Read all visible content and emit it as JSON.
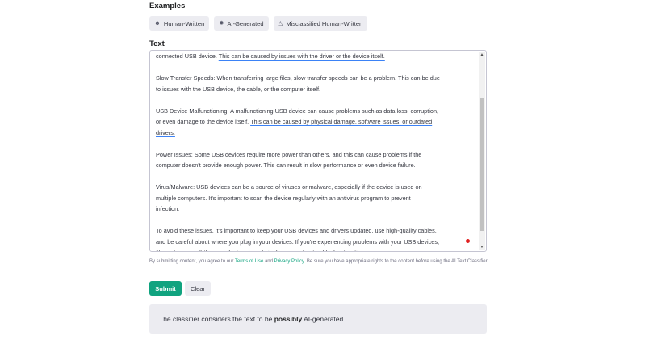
{
  "examples": {
    "title": "Examples",
    "chips": [
      {
        "icon": "user-icon",
        "label": "Human-Written"
      },
      {
        "icon": "openai-icon",
        "label": "AI-Generated"
      },
      {
        "icon": "warning-icon",
        "label": "Misclassified Human-Written"
      }
    ]
  },
  "text_section": {
    "title": "Text",
    "paragraphs": [
      {
        "lines": [
          [
            {
              "t": "connected USB device. "
            },
            {
              "t": "This can be caused by issues with the driver or the device itself.",
              "u": true
            }
          ]
        ]
      },
      {
        "lines": [
          [
            {
              "t": "Slow Transfer Speeds: When transferring large files, slow transfer speeds can be a problem. This can be due"
            }
          ],
          [
            {
              "t": "to issues with the USB device, the cable, or the computer itself."
            }
          ]
        ]
      },
      {
        "lines": [
          [
            {
              "t": "USB Device Malfunctioning: A malfunctioning USB device can cause problems such as data loss, corruption,"
            }
          ],
          [
            {
              "t": "or even damage to the device itself. "
            },
            {
              "t": "This can be caused by physical damage, software issues, or outdated",
              "u": true
            }
          ],
          [
            {
              "t": "drivers.",
              "u": true
            }
          ]
        ]
      },
      {
        "lines": [
          [
            {
              "t": "Power Issues: Some USB devices require more power than others, and this can cause problems if the"
            }
          ],
          [
            {
              "t": "computer doesn't provide enough power. This can result in slow performance or even device failure."
            }
          ]
        ]
      },
      {
        "lines": [
          [
            {
              "t": "Virus/Malware: USB devices can be a source of viruses or malware, especially if the device is used on"
            }
          ],
          [
            {
              "t": "multiple computers. It's important to scan the device regularly with an antivirus program to prevent"
            }
          ],
          [
            {
              "t": "infection."
            }
          ]
        ]
      },
      {
        "lines": [
          [
            {
              "t": "To avoid these issues, it's important to keep your USB devices and drivers updated, use high-quality cables,"
            }
          ],
          [
            {
              "t": "and be careful about where you plug in your devices. If you're experiencing problems with your USB devices,"
            }
          ],
          [
            {
              "t": "it's best to consult the manufacturer's website for support or troubleshooting tips."
            }
          ]
        ]
      }
    ]
  },
  "disclaimer": {
    "prefix": "By submitting content, you agree to our ",
    "terms_link": "Terms of Use",
    "and": " and ",
    "privacy_link": "Privacy Policy",
    "suffix": ". Be sure you have appropriate rights to the content before using the AI Text Classifier."
  },
  "buttons": {
    "submit": "Submit",
    "clear": "Clear"
  },
  "result": {
    "prefix": "The classifier considers the text to be ",
    "emphasis": "possibly",
    "suffix": " AI-generated."
  },
  "colors": {
    "accent": "#10a37f",
    "chip_bg": "#ececf1",
    "underline": "#3b82f6"
  }
}
